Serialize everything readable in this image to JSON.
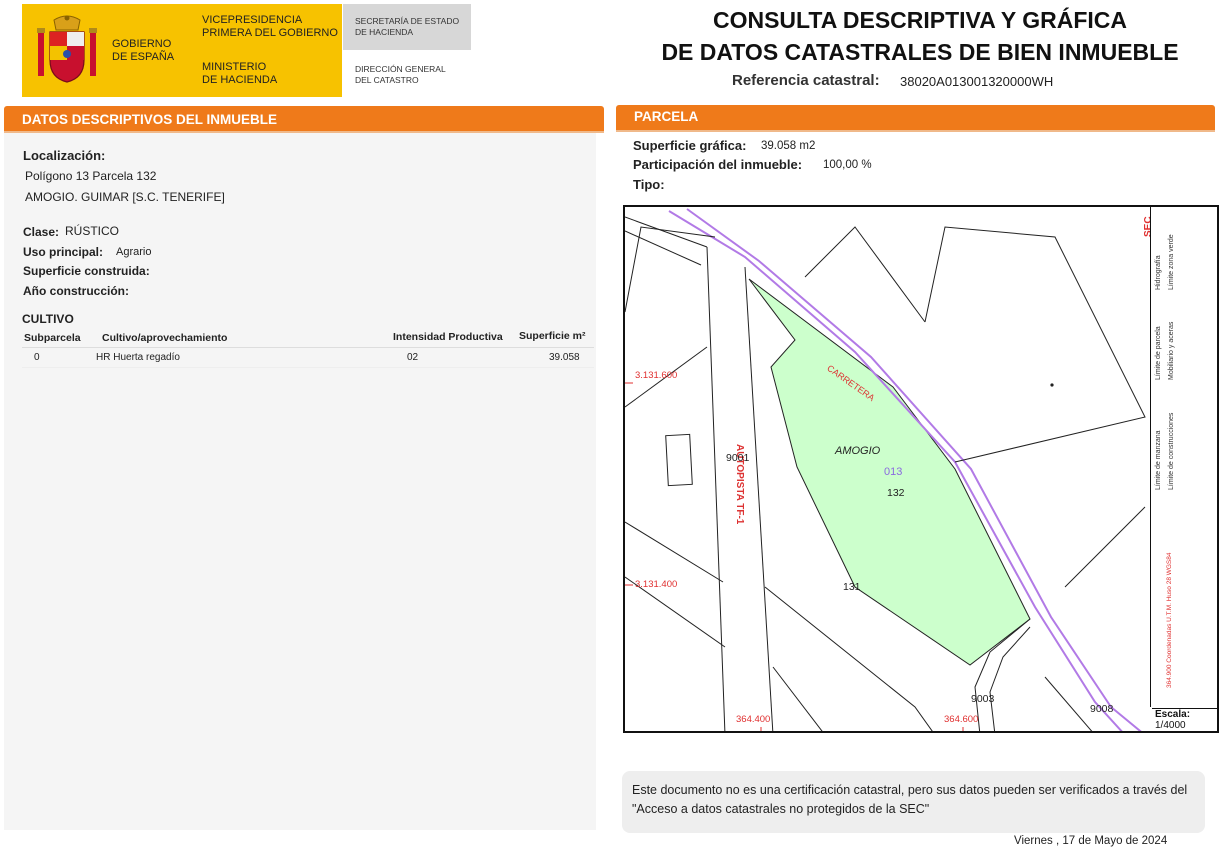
{
  "header": {
    "gov_line1": "GOBIERNO",
    "gov_line2": "DE ESPAÑA",
    "vice_line1": "VICEPRESIDENCIA",
    "vice_line2": "PRIMERA DEL GOBIERNO",
    "min_line1": "MINISTERIO",
    "min_line2": "DE HACIENDA",
    "sec_line1": "SECRETARÍA DE ESTADO",
    "sec_line2": "DE HACIENDA",
    "dir_line1": "DIRECCIÓN GENERAL",
    "dir_line2": "DEL CATASTRO",
    "title_line1": "CONSULTA DESCRIPTIVA Y GRÁFICA",
    "title_line2": "DE DATOS CATASTRALES DE BIEN INMUEBLE",
    "ref_label": "Referencia catastral:",
    "ref_value": "38020A013001320000WH"
  },
  "left": {
    "band_title": "DATOS DESCRIPTIVOS DEL INMUEBLE",
    "loc_label": "Localización:",
    "loc_line1": "Polígono 13 Parcela 132",
    "loc_line2": "AMOGIO. GUIMAR [S.C. TENERIFE]",
    "clase_label": "Clase:",
    "clase_value": "RÚSTICO",
    "uso_label": "Uso principal:",
    "uso_value": "Agrario",
    "sup_label": "Superficie construida:",
    "anio_label": "Año construcción:",
    "cultivo_title": "CULTIVO",
    "table": {
      "headers": [
        "Subparcela",
        "Cultivo/aprovechamiento",
        "Intensidad Productiva",
        "Superficie m²"
      ],
      "rows": [
        [
          "0",
          "HR Huerta regadío",
          "02",
          "39.058"
        ]
      ]
    }
  },
  "right": {
    "band_title": "PARCELA",
    "sup_label": "Superficie gráfica:",
    "sup_value": "39.058 m2",
    "part_label": "Participación del inmueble:",
    "part_value": "100,00 %",
    "tipo_label": "Tipo:",
    "map": {
      "coord_y1": "3.131.600",
      "coord_y2": "3.131.400",
      "coord_x1": "364.400",
      "coord_x2": "364.600",
      "road_label": "CARRETERA",
      "highway_label": "AUTOPISTA TF-1",
      "place_label": "AMOGIO",
      "polygon_num": "013",
      "parcel_num": "132",
      "parcel_131": "131",
      "label_9001": "9001",
      "label_9003": "9003",
      "label_9008": "9008",
      "sec_mark": "SEC",
      "legend": {
        "hidrografia": "Hidrografía",
        "zona_verde": "Límite zona verde",
        "parcela": "Límite de parcela",
        "mobiliario": "Mobiliario y aceras",
        "manzana": "Límite de manzana",
        "construcciones": "Límite de construcciones",
        "coords": "364.900 Coordenadas U.T.M. Huso 28 WGS84"
      },
      "scale_label": "Escala:",
      "scale_value": "1/4000",
      "colors": {
        "parcel_fill": "#ccffcc",
        "boundary": "#b27ae6",
        "coord_text": "#e03030"
      }
    },
    "note": "Este documento no es una certificación catastral, pero sus datos pueden ser verificados a través del \"Acceso a datos catastrales no protegidos de la SEC\"",
    "date": "Viernes , 17 de Mayo de 2024"
  }
}
